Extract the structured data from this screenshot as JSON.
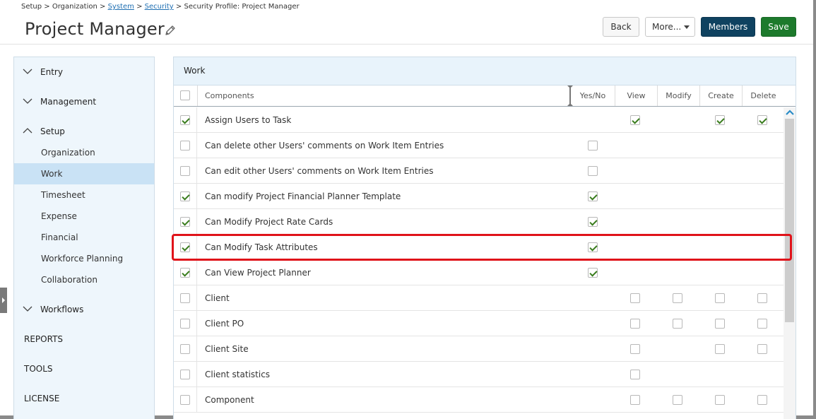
{
  "breadcrumb": {
    "setup": "Setup",
    "organization": "Organization",
    "system": "System",
    "security": "Security",
    "current": "Security Profile: Project Manager",
    "sep": ">"
  },
  "page": {
    "title": "Project Manager"
  },
  "toolbar": {
    "back_label": "Back",
    "more_label": "More...",
    "members_label": "Members",
    "save_label": "Save"
  },
  "sidebar": {
    "sections": [
      {
        "label": "Entry",
        "expanded": false
      },
      {
        "label": "Management",
        "expanded": false
      },
      {
        "label": "Setup",
        "expanded": true
      },
      {
        "label": "Workflows",
        "expanded": false
      }
    ],
    "setup_items": [
      {
        "label": "Organization",
        "active": false
      },
      {
        "label": "Work",
        "active": true
      },
      {
        "label": "Timesheet",
        "active": false
      },
      {
        "label": "Expense",
        "active": false
      },
      {
        "label": "Financial",
        "active": false
      },
      {
        "label": "Workforce Planning",
        "active": false
      },
      {
        "label": "Collaboration",
        "active": false
      }
    ],
    "top_items": [
      {
        "label": "REPORTS"
      },
      {
        "label": "TOOLS"
      },
      {
        "label": "LICENSE"
      }
    ]
  },
  "panel": {
    "title": "Work",
    "columns": {
      "components": "Components",
      "yesno": "Yes/No",
      "view": "View",
      "modify": "Modify",
      "create": "Create",
      "delete": "Delete"
    },
    "rows": [
      {
        "name": "Assign Users to Task",
        "selected": true,
        "yesno": null,
        "view": true,
        "modify": null,
        "create": true,
        "delete": true
      },
      {
        "name": "Can delete other Users' comments on Work Item Entries",
        "selected": false,
        "yesno": false,
        "view": null,
        "modify": null,
        "create": null,
        "delete": null
      },
      {
        "name": "Can edit other Users' comments on Work Item Entries",
        "selected": false,
        "yesno": false,
        "view": null,
        "modify": null,
        "create": null,
        "delete": null
      },
      {
        "name": "Can modify Project Financial Planner Template",
        "selected": true,
        "yesno": true,
        "view": null,
        "modify": null,
        "create": null,
        "delete": null
      },
      {
        "name": "Can Modify Project Rate Cards",
        "selected": true,
        "yesno": true,
        "view": null,
        "modify": null,
        "create": null,
        "delete": null
      },
      {
        "name": "Can Modify Task Attributes",
        "selected": true,
        "yesno": true,
        "view": null,
        "modify": null,
        "create": null,
        "delete": null
      },
      {
        "name": "Can View Project Planner",
        "selected": true,
        "yesno": true,
        "view": null,
        "modify": null,
        "create": null,
        "delete": null
      },
      {
        "name": "Client",
        "selected": false,
        "yesno": null,
        "view": false,
        "modify": false,
        "create": false,
        "delete": false
      },
      {
        "name": "Client PO",
        "selected": false,
        "yesno": null,
        "view": false,
        "modify": false,
        "create": false,
        "delete": false
      },
      {
        "name": "Client Site",
        "selected": false,
        "yesno": null,
        "view": false,
        "modify": null,
        "create": false,
        "delete": false
      },
      {
        "name": "Client statistics",
        "selected": false,
        "yesno": null,
        "view": false,
        "modify": null,
        "create": null,
        "delete": null
      },
      {
        "name": "Component",
        "selected": false,
        "yesno": null,
        "view": false,
        "modify": false,
        "create": false,
        "delete": false
      }
    ]
  },
  "colors": {
    "members_button": "#0f4260",
    "save_button": "#1d7a2c",
    "highlight_outline": "#e0131a",
    "active_nav": "#c9e2f5",
    "check": "#3a7d1e"
  },
  "icons": {
    "edit": "pencil-icon",
    "collapsed": "chevron-down-icon",
    "expanded": "chevron-up-icon",
    "scroll_up": "chevron-up-icon"
  }
}
